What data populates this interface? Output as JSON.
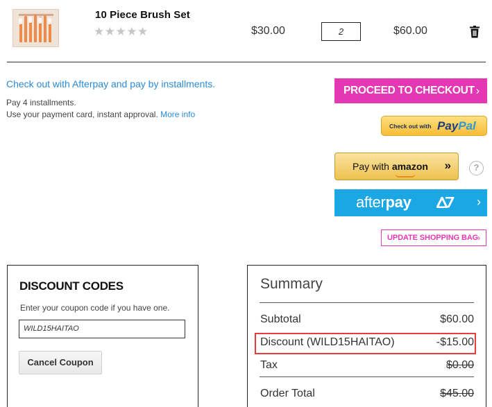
{
  "product": {
    "name": "10 Piece Brush Set",
    "stars": "★★★★★",
    "unit_price": "$30.00",
    "quantity": "2",
    "line_total": "$60.00"
  },
  "afterpay_info": {
    "headline": "Check out with Afterpay and pay by installments.",
    "line1": "Pay 4 installments.",
    "line2": "Use your payment card, instant approval.",
    "more_link": "More info"
  },
  "buttons": {
    "checkout": "PROCEED TO CHECKOUT",
    "checkout_chevron": "›",
    "paypal_prefix": "Check out with",
    "paypal_pay": "Pay",
    "paypal_pal": "Pal",
    "amazon_prefix": "Pay with",
    "amazon_brand": "amazon",
    "amazon_arrows": "»",
    "help": "?",
    "afterpay_light": "after",
    "afterpay_bold": "pay",
    "afterpay_chevron": "›",
    "update_bag": "UPDATE SHOPPING BAG",
    "update_chevron": "›"
  },
  "discount": {
    "title": "DISCOUNT CODES",
    "help_text": "Enter your coupon code if you have one.",
    "code": "WILD15HAITAO",
    "cancel_label": "Cancel Coupon"
  },
  "summary": {
    "title": "Summary",
    "subtotal_label": "Subtotal",
    "subtotal_value": "$60.00",
    "discount_label": "Discount (WILD15HAITAO)",
    "discount_value": "-$15.00",
    "tax_label": "Tax",
    "tax_value": "$0.00",
    "total_label": "Order Total",
    "total_value": "$45.00"
  },
  "colors": {
    "accent_pink": "#e437b3",
    "link_blue": "#2b8ad4",
    "afterpay_blue": "#1ba6e4",
    "highlight_red": "#e63d3d"
  }
}
